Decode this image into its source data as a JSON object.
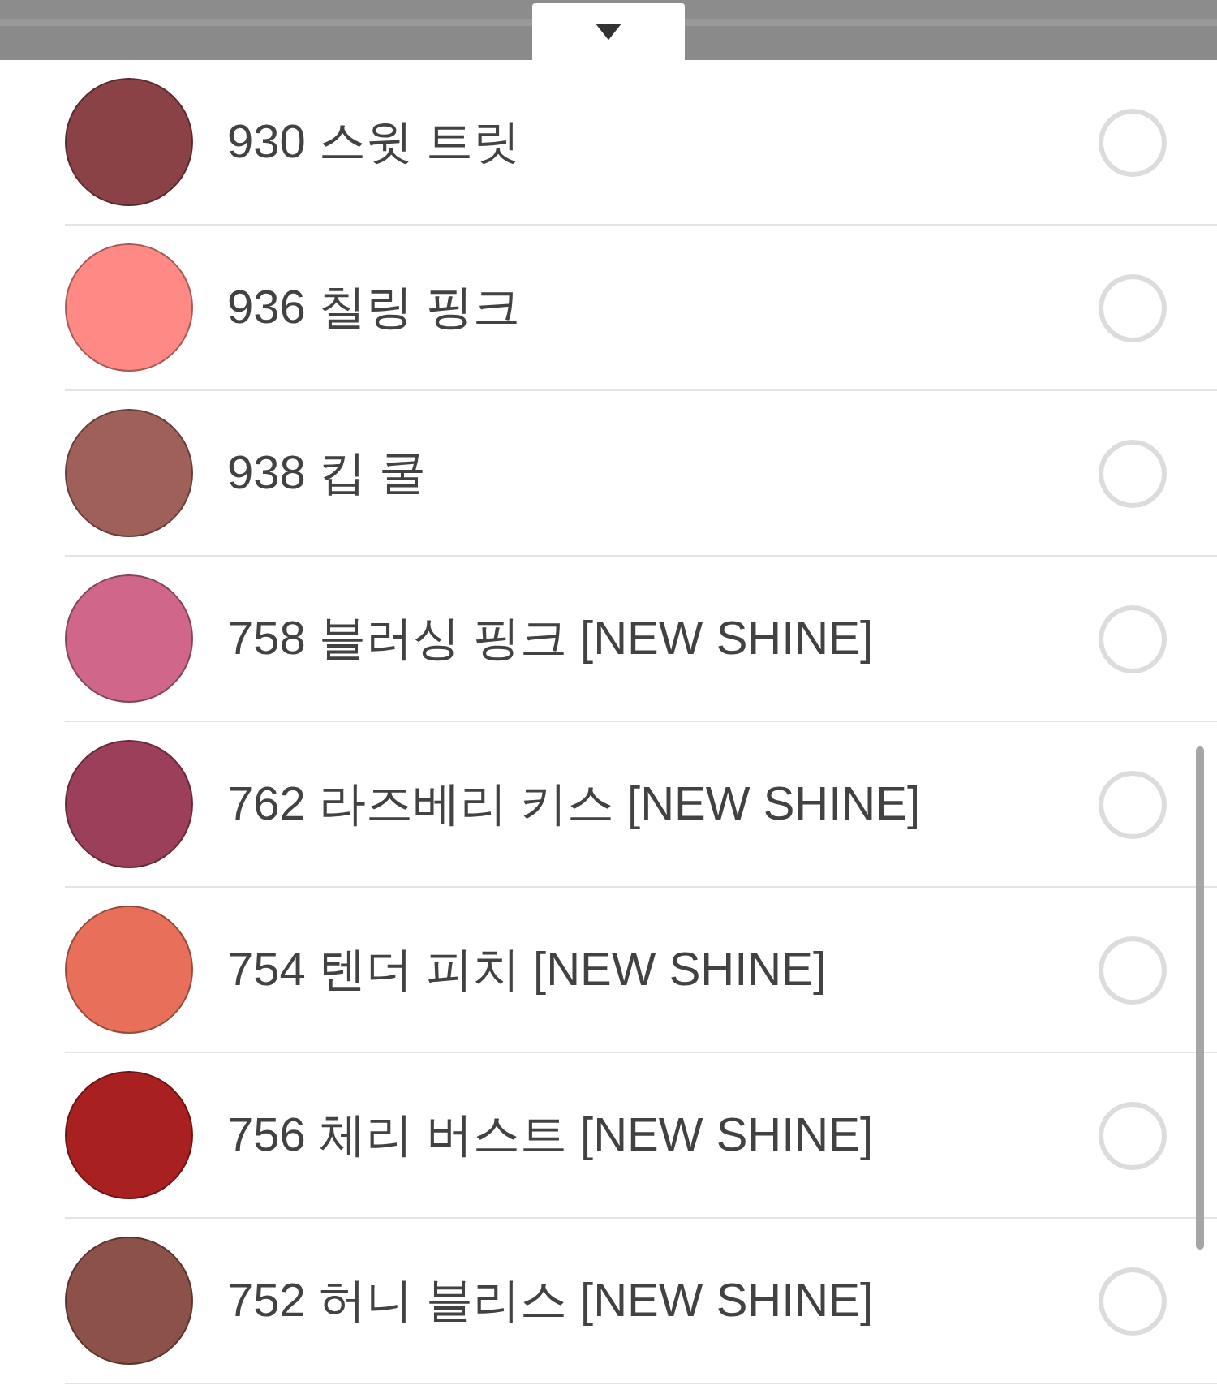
{
  "header": {
    "toggle": "▼"
  },
  "options": [
    {
      "label": "930 스윗 트릿",
      "color": "#8b4246",
      "selected": false
    },
    {
      "label": "936 칠링 핑크",
      "color": "#ff8a85",
      "selected": false
    },
    {
      "label": "938 킵 쿨",
      "color": "#a0605a",
      "selected": false
    },
    {
      "label": "758 블러싱 핑크 [NEW SHINE]",
      "color": "#d0678a",
      "selected": false
    },
    {
      "label": "762 라즈베리 키스 [NEW SHINE]",
      "color": "#9c3f5a",
      "selected": false
    },
    {
      "label": "754 텐더 피치 [NEW SHINE]",
      "color": "#e8705a",
      "selected": false
    },
    {
      "label": "756 체리 버스트 [NEW SHINE]",
      "color": "#a8201f",
      "selected": false
    },
    {
      "label": "752 허니 블리스 [NEW SHINE]",
      "color": "#8c5148",
      "selected": false
    }
  ]
}
